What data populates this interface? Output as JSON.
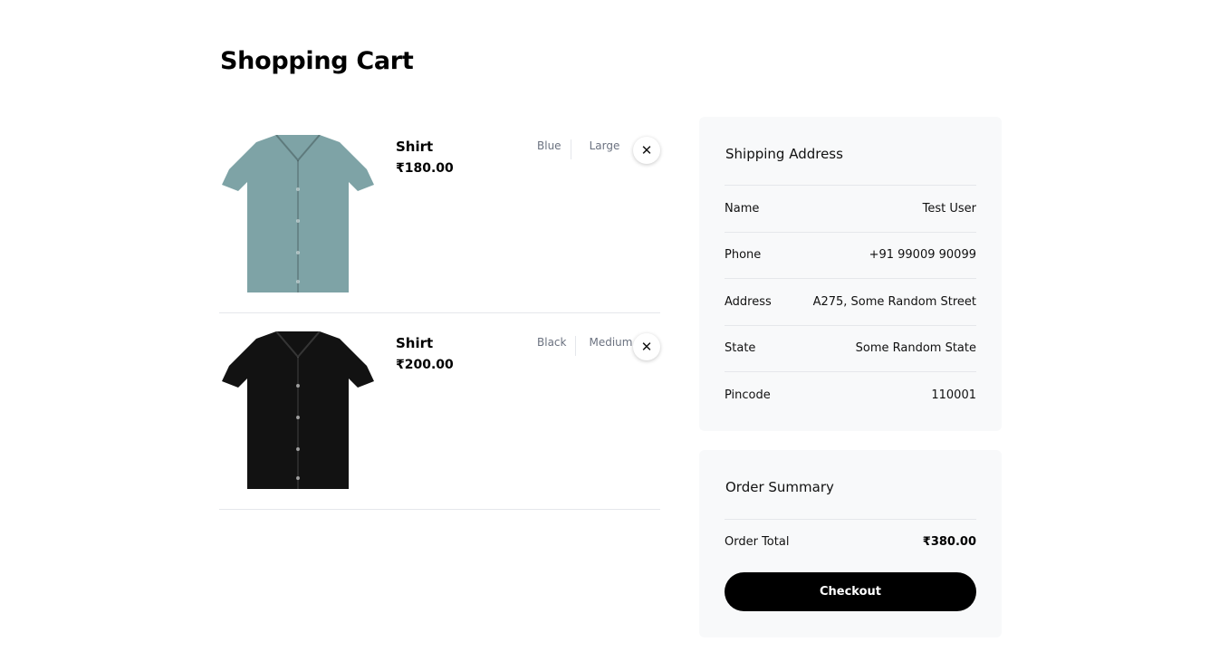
{
  "page": {
    "title": "Shopping Cart"
  },
  "cart": {
    "items": [
      {
        "name": "Shirt",
        "price": "₹180.00",
        "color": "Blue",
        "size": "Large",
        "shirt_color": "#7ea3a6",
        "remove_icon": "close-icon"
      },
      {
        "name": "Shirt",
        "price": "₹200.00",
        "color": "Black",
        "size": "Medium",
        "shirt_color": "#121212",
        "remove_icon": "close-icon"
      }
    ]
  },
  "shipping": {
    "title": "Shipping Address",
    "rows": [
      {
        "label": "Name",
        "value": "Test User"
      },
      {
        "label": "Phone",
        "value": "+91 99009 90099"
      },
      {
        "label": "Address",
        "value": "A275, Some Random Street"
      },
      {
        "label": "State",
        "value": "Some Random State"
      },
      {
        "label": "Pincode",
        "value": "110001"
      }
    ]
  },
  "summary": {
    "title": "Order Summary",
    "total_label": "Order Total",
    "total_value": "₹380.00",
    "checkout_label": "Checkout"
  },
  "colors": {
    "panel_bg": "#f8f9fa",
    "button_bg": "#000000",
    "muted_text": "#6b7280",
    "divider": "#e5e7eb"
  }
}
